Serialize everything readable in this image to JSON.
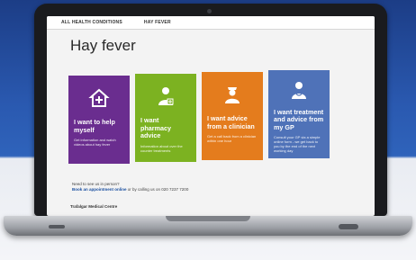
{
  "breadcrumb": {
    "item1": "ALL HEALTH CONDITIONS",
    "item2": "HAY FEVER"
  },
  "page": {
    "title": "Hay fever"
  },
  "cards": [
    {
      "title": "I want to help myself",
      "desc": "Get information and watch videos about hay fever",
      "icon": "house-plus-icon"
    },
    {
      "title": "I want pharmacy advice",
      "desc": "Information about over the counter treatments",
      "icon": "pharmacist-icon"
    },
    {
      "title": "I want advice from a clinician",
      "desc": "Get a call back from a clinician within one hour",
      "icon": "nurse-icon"
    },
    {
      "title": "I want treatment and advice from my GP",
      "desc": "Consult your GP via a simple online form - we get back to you by the end of the next working day",
      "icon": "doctor-icon"
    }
  ],
  "footer": {
    "line1": "Need to see us in person?",
    "link_label": "Book an appointment online",
    "line2_rest": "or by calling us on 020 7237 7200",
    "org": "Trafalgar Medical Centre"
  },
  "colors": {
    "purple": "#6a2d8f",
    "green": "#7cb221",
    "orange": "#e47c1d",
    "blue": "#4f72b8"
  }
}
